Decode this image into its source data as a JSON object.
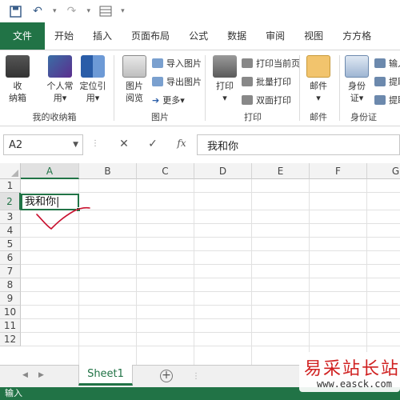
{
  "qat": {
    "dropdown": "▾"
  },
  "tabs": [
    "文件",
    "开始",
    "插入",
    "页面布局",
    "公式",
    "数据",
    "审阅",
    "视图",
    "方方格"
  ],
  "ribbon": {
    "groups": [
      {
        "label": "我的收纳箱",
        "buttons": [
          "收\n纳箱",
          "个人常\n用▾",
          "定位引\n用▾"
        ]
      },
      {
        "label": "图片",
        "buttons": [
          "图片\n阅览"
        ],
        "small": [
          "导入图片",
          "导出图片",
          "更多▾"
        ]
      },
      {
        "label": "打印",
        "buttons": [
          "打印\n▾"
        ],
        "small": [
          "打印当前页",
          "批量打印",
          "双面打印"
        ]
      },
      {
        "label": "邮件",
        "buttons": [
          "邮件\n▾"
        ]
      },
      {
        "label": "身份证",
        "buttons": [
          "身份\n证▾"
        ],
        "small": [
          "输入身",
          "提取",
          "提取"
        ]
      }
    ]
  },
  "formula_bar": {
    "name_box": "A2",
    "content": "我和你",
    "fx": "fx"
  },
  "columns": [
    "A",
    "B",
    "C",
    "D",
    "E",
    "F",
    "G"
  ],
  "rows": [
    "1",
    "2",
    "3",
    "4",
    "5",
    "6",
    "7",
    "8",
    "9",
    "10",
    "11",
    "12"
  ],
  "cells": {
    "A2": "我和你"
  },
  "sheets": [
    "Sheet1"
  ],
  "status": "输入",
  "watermark": {
    "title": "易采站长站",
    "url": "www.easck.com"
  },
  "colors": {
    "accent": "#217346",
    "annotation": "#c8102e"
  }
}
